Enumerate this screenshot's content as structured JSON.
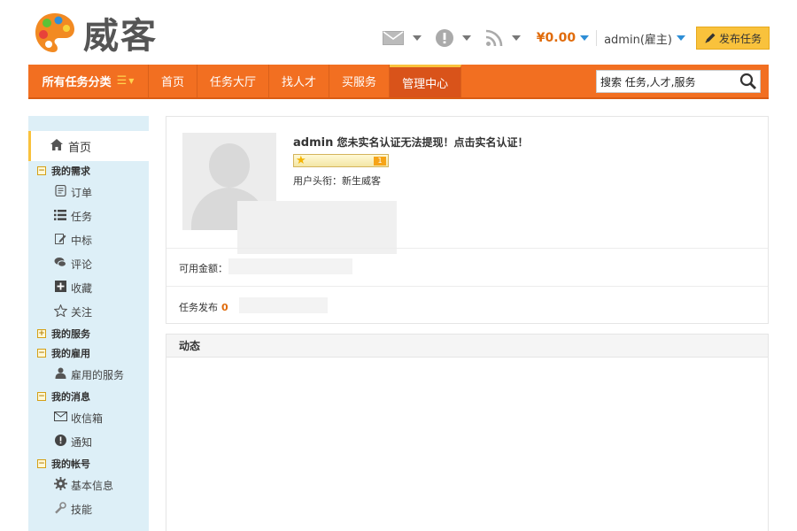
{
  "brand": {
    "name": "威客"
  },
  "header": {
    "balance": "¥0.00",
    "user": "admin(雇主)",
    "publish_label": "发布任务"
  },
  "nav": {
    "category_label": "所有任务分类",
    "items": [
      "首页",
      "任务大厅",
      "找人才",
      "买服务",
      "管理中心"
    ],
    "active_index": 4,
    "search_value": "搜索 任务,人才,服务"
  },
  "sidebar": {
    "home": "首页",
    "groups": [
      {
        "label": "我的需求",
        "expanded": true,
        "items": [
          {
            "label": "订单",
            "icon": "order-icon"
          },
          {
            "label": "任务",
            "icon": "list-icon"
          },
          {
            "label": "中标",
            "icon": "edit-icon"
          },
          {
            "label": "评论",
            "icon": "comment-icon"
          },
          {
            "label": "收藏",
            "icon": "plus-square-icon"
          },
          {
            "label": "关注",
            "icon": "star-icon"
          }
        ]
      },
      {
        "label": "我的服务",
        "expanded": false,
        "items": []
      },
      {
        "label": "我的雇用",
        "expanded": true,
        "items": [
          {
            "label": "雇用的服务",
            "icon": "user-icon"
          }
        ]
      },
      {
        "label": "我的消息",
        "expanded": true,
        "items": [
          {
            "label": "收信箱",
            "icon": "mail-icon"
          },
          {
            "label": "通知",
            "icon": "info-icon"
          }
        ]
      },
      {
        "label": "我的帐号",
        "expanded": true,
        "items": [
          {
            "label": "基本信息",
            "icon": "gear-icon"
          },
          {
            "label": "技能",
            "icon": "wrench-icon"
          }
        ]
      }
    ]
  },
  "profile": {
    "name": "admin",
    "notice": "您未实名认证无法提现！点击实名认证！",
    "level": "1",
    "title": "用户头衔：新生威客",
    "available_label": "可用金额：",
    "tasks_label": "任务发布",
    "tasks_count": "0"
  },
  "feed": {
    "title": "动态"
  }
}
